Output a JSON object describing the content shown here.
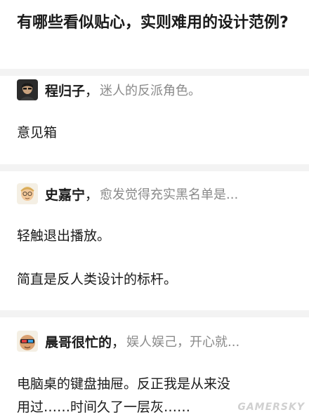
{
  "question": {
    "title": "有哪些看似贴心，实则难用的设计范例?"
  },
  "answers": [
    {
      "author": "程归子",
      "separator": "，",
      "bio": "迷人的反派角色。",
      "paragraphs": [
        "意见箱"
      ]
    },
    {
      "author": "史嘉宁",
      "separator": "，",
      "bio": "愈发觉得充实黑名单是...",
      "paragraphs": [
        "轻触退出播放。",
        "简直是反人类设计的标杆。"
      ]
    },
    {
      "author": "晨哥很忙的",
      "separator": "，",
      "bio": "娱人娱己，开心就...",
      "paragraphs": [
        "电脑桌的键盘抽屉。反正我是从来没",
        "用过……时间久了一层灰……"
      ]
    }
  ],
  "watermark": "GAMERSKY",
  "colors": {
    "background": "#ffffff",
    "divider": "#f3f3f3",
    "primary_text": "#1a1a1a",
    "secondary_text": "#8a8a8a"
  }
}
